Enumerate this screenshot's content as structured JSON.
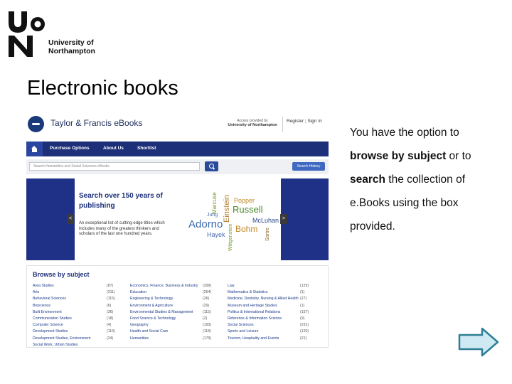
{
  "logo": {
    "line1": "University of",
    "line2": "Northampton",
    "icon": "uon-logo-icon"
  },
  "slide_title": "Electronic books",
  "screenshot": {
    "brand": "Taylor & Francis eBooks",
    "access_line1": "Access provided by",
    "access_line2": "University of Northampton",
    "register": "Register",
    "signin": "Sign In",
    "nav": [
      "Purchase Options",
      "About Us",
      "Shortlist"
    ],
    "search_placeholder": "Search Humanities and Social Sciences eBooks",
    "search_history": "Search History",
    "hero_title": "Search over 150 years of publishing",
    "hero_sub": "An exceptional list of cutting-edge titles which includes many of the greatest thinkers and scholars of the last one hundred years.",
    "cloud_words": [
      "Marcuse",
      "Popper",
      "Russell",
      "Einstein",
      "Jung",
      "McLuhan",
      "Adorno",
      "Bohm",
      "Hayek",
      "Sartre",
      "Wittgenstein"
    ],
    "browse_title": "Browse by subject",
    "subjects_col1": [
      {
        "name": "Area Studies",
        "count": "(87)"
      },
      {
        "name": "Arts",
        "count": "(211)"
      },
      {
        "name": "Behavioral Sciences",
        "count": "(115)"
      },
      {
        "name": "Bioscience",
        "count": "(6)"
      },
      {
        "name": "Built Environment",
        "count": "(36)"
      },
      {
        "name": "Communication Studies",
        "count": "(18)"
      },
      {
        "name": "Computer Science",
        "count": "(4)"
      },
      {
        "name": "Development Studies",
        "count": "(119)"
      },
      {
        "name": "Development Studies, Environment",
        "count": "(24)"
      },
      {
        "name": "Social Work, Urban Studies",
        "count": ""
      }
    ],
    "subjects_col2": [
      {
        "name": "Economics, Finance, Business & Industry",
        "count": "(299)"
      },
      {
        "name": "Education",
        "count": "(264)"
      },
      {
        "name": "Engineering & Technology",
        "count": "(26)"
      },
      {
        "name": "Environment & Agriculture",
        "count": "(29)"
      },
      {
        "name": "Environmental Studies & Management",
        "count": "(115)"
      },
      {
        "name": "Food Science & Technology",
        "count": "(2)"
      },
      {
        "name": "Geography",
        "count": "(193)"
      },
      {
        "name": "Health and Social Care",
        "count": "(118)"
      },
      {
        "name": "Humanities",
        "count": "(179)"
      }
    ],
    "subjects_col3": [
      {
        "name": "Law",
        "count": "(129)"
      },
      {
        "name": "Mathematics & Statistics",
        "count": "(1)"
      },
      {
        "name": "Medicine, Dentistry, Nursing & Allied Health",
        "count": "(27)"
      },
      {
        "name": "Museum and Heritage Studies",
        "count": "(1)"
      },
      {
        "name": "Politics & International Relations",
        "count": "(157)"
      },
      {
        "name": "Reference & Information Science",
        "count": "(9)"
      },
      {
        "name": "Social Sciences",
        "count": "(231)"
      },
      {
        "name": "Sports and Leisure",
        "count": "(120)"
      },
      {
        "name": "Tourism, Hospitality and Events",
        "count": "(21)"
      }
    ]
  },
  "body": {
    "line1": "You have the option to",
    "line2_bold": "browse by subject",
    "line2_rest": " or to",
    "line3_bold": "search",
    "line3_rest": " the collection of",
    "line4": "e.Books using the box",
    "line5": "provided."
  },
  "next_icon": "next-arrow-icon",
  "colors": {
    "nav_blue": "#1c2f78",
    "hero_blue": "#1f3087",
    "arrow_fill": "#cfe9f3",
    "arrow_stroke": "#2e7f96"
  }
}
